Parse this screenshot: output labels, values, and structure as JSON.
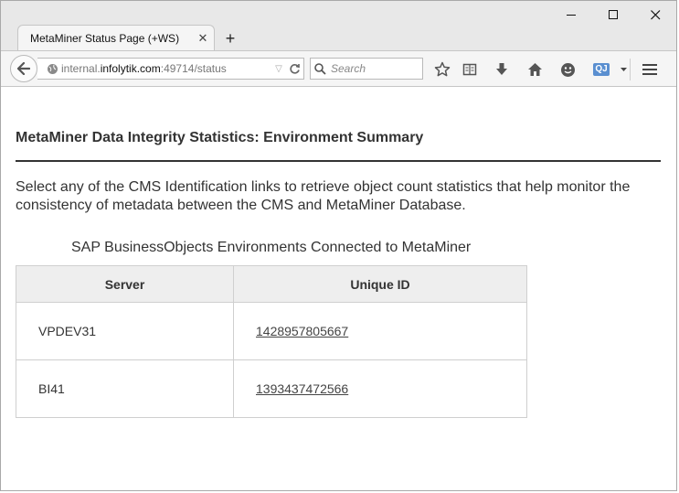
{
  "browser": {
    "tab_title": "MetaMiner Status Page (+WS)",
    "tab_close_glyph": "✕",
    "new_tab_glyph": "+",
    "url": {
      "prefix": "internal.",
      "domain": "infolytik.com",
      "suffix": ":49714/status"
    },
    "search_placeholder": "Search",
    "qj_badge": "QJ"
  },
  "page": {
    "title": "MetaMiner Data Integrity Statistics: Environment Summary",
    "intro": "Select any of the CMS Identification links to retrieve object count statistics that help monitor the consistency of metadata between the CMS and MetaMiner Database.",
    "caption": "SAP BusinessObjects Environments Connected to MetaMiner",
    "table": {
      "headers": [
        "Server",
        "Unique ID"
      ],
      "rows": [
        {
          "server": "VPDEV31",
          "unique_id": "1428957805667"
        },
        {
          "server": "BI41",
          "unique_id": "1393437472566"
        }
      ]
    }
  }
}
